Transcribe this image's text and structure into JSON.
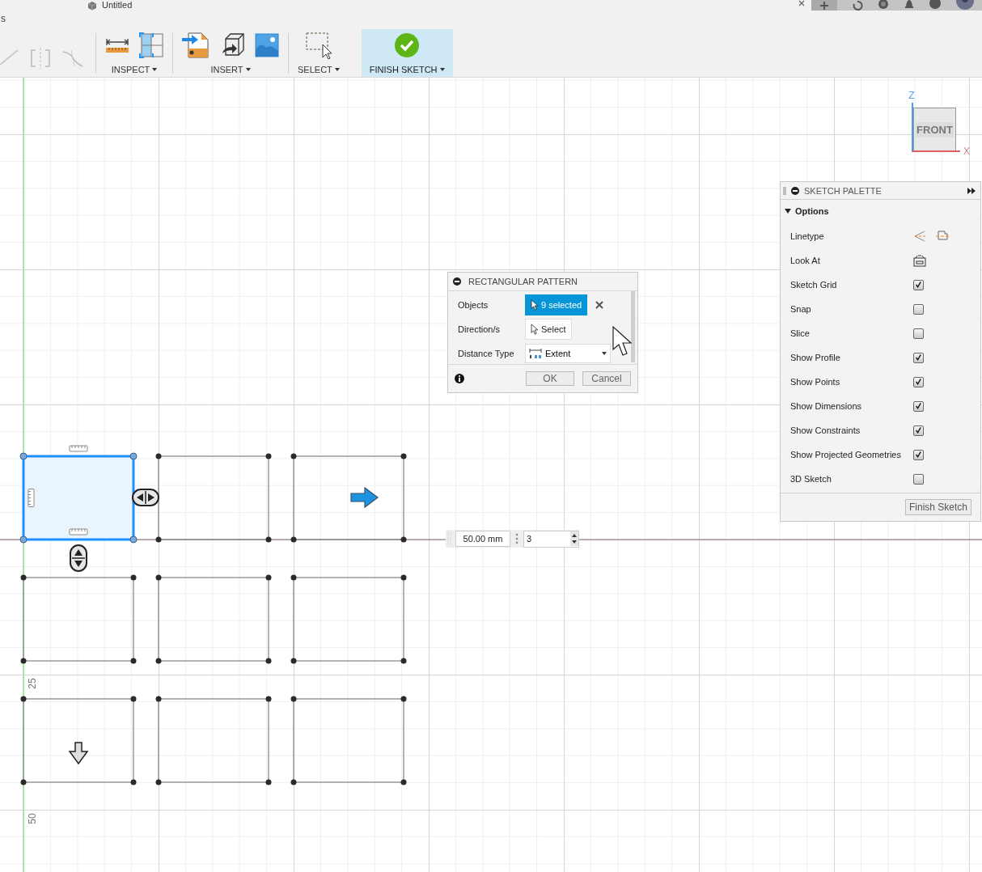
{
  "title_bar": {
    "document_title": "Untitled",
    "menu_fragment": "s"
  },
  "toolbar": {
    "groups": [
      {
        "label": "INSPECT",
        "kind": "inspect",
        "selected": false
      },
      {
        "label": "INSERT",
        "kind": "insert",
        "selected": false
      },
      {
        "label": "SELECT",
        "kind": "select",
        "selected": false
      },
      {
        "label": "FINISH SKETCH",
        "kind": "finish",
        "selected": true
      }
    ]
  },
  "view_cube": {
    "face": "FRONT",
    "vertical_axis": "Z",
    "horizontal_axis": "X"
  },
  "sketch_rectangles": [
    {
      "selected": true
    },
    {
      "selected": false
    },
    {
      "selected": false
    },
    {
      "selected": false
    },
    {
      "selected": false
    },
    {
      "selected": false
    },
    {
      "selected": false
    },
    {
      "selected": false
    },
    {
      "selected": false
    }
  ],
  "axis_labels": [
    "25",
    "50"
  ],
  "dimension_input": {
    "distance": "50.00 mm",
    "count": "3"
  },
  "rectangular_pattern": {
    "title": "RECTANGULAR PATTERN",
    "rows": [
      {
        "label": "Objects",
        "kind": "selection",
        "value": "9 selected",
        "selected": true
      },
      {
        "label": "Direction/s",
        "kind": "selection",
        "value": "Select",
        "selected": false
      },
      {
        "label": "Distance Type",
        "kind": "dropdown",
        "value": "Extent"
      }
    ],
    "buttons": [
      "OK",
      "Cancel"
    ]
  },
  "sketch_palette": {
    "title": "SKETCH PALETTE",
    "section": {
      "label": "Options",
      "expanded": true
    },
    "options": [
      {
        "label": "Linetype",
        "kind": "linetype"
      },
      {
        "label": "Look At",
        "kind": "look_at"
      },
      {
        "label": "Sketch Grid",
        "kind": "checkbox",
        "checked": true
      },
      {
        "label": "Snap",
        "kind": "checkbox",
        "checked": false
      },
      {
        "label": "Slice",
        "kind": "checkbox",
        "checked": false
      },
      {
        "label": "Show Profile",
        "kind": "checkbox",
        "checked": true
      },
      {
        "label": "Show Points",
        "kind": "checkbox",
        "checked": true
      },
      {
        "label": "Show Dimensions",
        "kind": "checkbox",
        "checked": true
      },
      {
        "label": "Show Constraints",
        "kind": "checkbox",
        "checked": true
      },
      {
        "label": "Show Projected Geometries",
        "kind": "checkbox",
        "checked": true
      },
      {
        "label": "3D Sketch",
        "kind": "checkbox",
        "checked": false
      }
    ],
    "button": "Finish Sketch"
  }
}
